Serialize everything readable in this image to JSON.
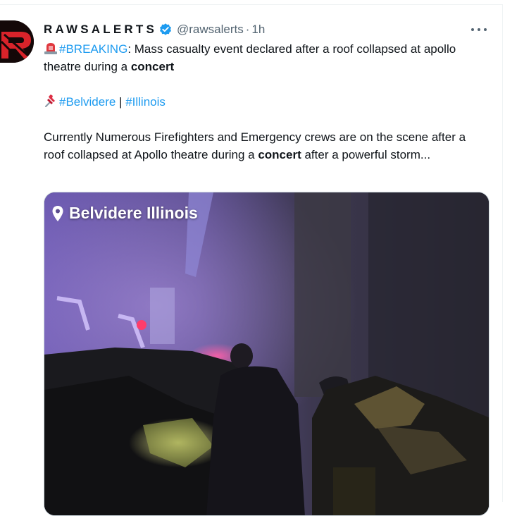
{
  "tweet": {
    "author_name": "RAWSALERTS",
    "handle": "@rawsalerts",
    "separator": "·",
    "time": "1h",
    "line1": {
      "emoji": "rotating-light-icon",
      "hashtag": "#BREAKING",
      "text_a": ": Mass casualty event declared after a roof collapsed at apollo theatre during a ",
      "bold": "concert"
    },
    "line2": {
      "emoji": "pushpin-icon",
      "tag1": "#Belvidere",
      "sep": " | ",
      "tag2": "#Illinois"
    },
    "line3": {
      "text_a": "Currently Numerous Firefighters and Emergency crews are on the scene after a roof collapsed at Apollo theatre during a ",
      "bold": "concert",
      "text_b": " after a powerful storm..."
    }
  },
  "media": {
    "location_label": "Belvidere Illinois",
    "location_icon": "location-pin-icon"
  },
  "colors": {
    "link": "#1d9bf0",
    "secondary": "#536471",
    "verified": "#1d9bf0",
    "avatar_red": "#d8232a"
  }
}
